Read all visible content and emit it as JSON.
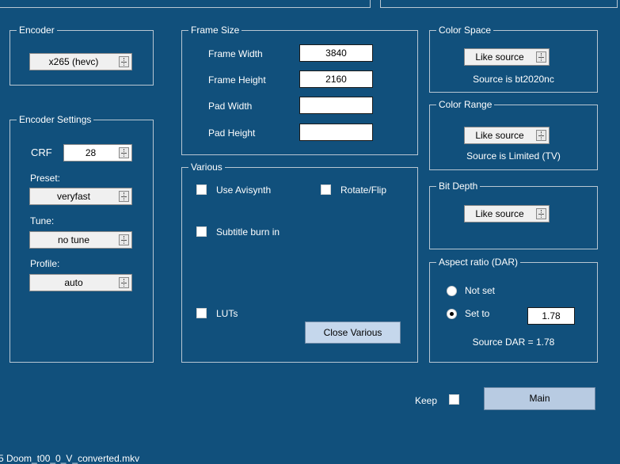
{
  "encoder": {
    "title": "Encoder",
    "value": "x265 (hevc)"
  },
  "encoder_settings": {
    "title": "Encoder Settings",
    "crf_label": "CRF",
    "crf_value": "28",
    "preset_label": "Preset:",
    "preset_value": "veryfast",
    "tune_label": "Tune:",
    "tune_value": "no tune",
    "profile_label": "Profile:",
    "profile_value": "auto"
  },
  "frame_size": {
    "title": "Frame Size",
    "width_label": "Frame Width",
    "width_value": "3840",
    "height_label": "Frame Height",
    "height_value": "2160",
    "pad_width_label": "Pad Width",
    "pad_width_value": "",
    "pad_height_label": "Pad Height",
    "pad_height_value": ""
  },
  "various": {
    "title": "Various",
    "use_avisynth": "Use Avisynth",
    "rotate_flip": "Rotate/Flip",
    "subtitle_burn": "Subtitle burn in",
    "luts": "LUTs",
    "close_button": "Close Various"
  },
  "color_space": {
    "title": "Color Space",
    "value": "Like source",
    "source_text": "Source is bt2020nc"
  },
  "color_range": {
    "title": "Color Range",
    "value": "Like source",
    "source_text": "Source is Limited (TV)"
  },
  "bit_depth": {
    "title": "Bit Depth",
    "value": "Like source"
  },
  "aspect": {
    "title": "Aspect ratio (DAR)",
    "not_set": "Not set",
    "set_to": "Set to",
    "set_to_value": "1.78",
    "source_text": "Source DAR = 1.78",
    "selected": "set_to"
  },
  "footer": {
    "keep_label": "Keep",
    "main_button": "Main",
    "status_text": "5 Doom_t00_0_V_converted.mkv"
  }
}
